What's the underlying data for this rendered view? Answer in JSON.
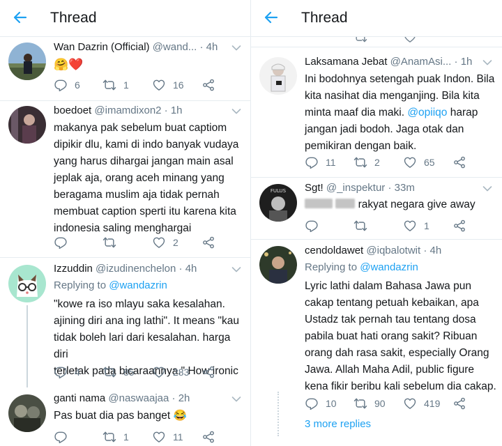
{
  "header": {
    "title": "Thread"
  },
  "left": [
    {
      "name": "Wan Dazrin (Official)",
      "handle": "@wand...",
      "dot": "·",
      "time": "4h",
      "body": [
        "🤗❤️"
      ],
      "reply": "6",
      "retweet": "1",
      "like": "16"
    },
    {
      "name": "boedoet",
      "handle": "@imamdixon2",
      "dot": "·",
      "time": "1h",
      "body": [
        "makanya pak sebelum buat captiom",
        "dipikir dlu, kami di indo banyak vudaya",
        "yang harus dihargai jangan main asal",
        "jeplak aja, orang aceh minang yang",
        "beragama muslim aja tidak pernah",
        "membuat caption sperti itu karena kita",
        "indonesia saling menghargai"
      ],
      "reply": "",
      "retweet": "",
      "like": "2"
    },
    {
      "name": "Izzuddin",
      "handle": "@izudinenchelon",
      "dot": "·",
      "time": "4h",
      "replying_prefix": "Replying to",
      "replying_to": "@wandazrin",
      "body": [
        "\"kowe ra iso mlayu saka kesalahan.",
        "ajining diri ana ing lathi\". It means \"kau",
        "tidak boleh lari dari kesalahan. harga diri",
        "terletak pada bicaraannya.\" How ironic"
      ],
      "reply": "4",
      "retweet": "85",
      "like": "283"
    },
    {
      "name": "ganti nama",
      "handle": "@naswaajaa",
      "dot": "·",
      "time": "2h",
      "body": [
        "Pas buat dia pas banget 😂"
      ],
      "reply": "",
      "retweet": "1",
      "like": "11"
    }
  ],
  "right": [
    {
      "name": "Laksamana Jebat",
      "handle": "@AnamAsi...",
      "dot": "·",
      "time": "1h",
      "body": [
        "Ini bodohnya setengah puak Indon. Bila",
        "kita nasihat dia menganjing. Bila kita",
        "minta maaf dia maki. ",
        "jangan jadi bodoh. Jaga otak dan",
        "pemikiran dengan baik."
      ],
      "mention": "@opiiqo",
      "mention_after": " harap",
      "reply": "11",
      "retweet": "2",
      "like": "65"
    },
    {
      "name": "Sgt!",
      "handle": "@_inspektur",
      "dot": "·",
      "time": "33m",
      "body": [
        "rakyat negara give away"
      ],
      "reply": "",
      "retweet": "",
      "like": "1",
      "avatar_text": "FULUS"
    },
    {
      "name": "cendoldawet",
      "handle": "@iqbalotwit",
      "dot": "·",
      "time": "4h",
      "replying_prefix": "Replying to",
      "replying_to": "@wandazrin",
      "body": [
        "Lyric lathi dalam Bahasa Jawa pun",
        "cakap tentang petuah kebaikan, apa",
        "Ustadz tak pernah tau tentang dosa",
        "pabila buat hati orang sakit? Ribuan",
        "orang dah rasa sakit, especially Orang",
        "Jawa. Allah Maha Adil, public figure",
        "kena fikir beribu kali sebelum dia cakap."
      ],
      "reply": "10",
      "retweet": "90",
      "like": "419"
    }
  ],
  "more_replies": "3 more replies",
  "colors": {
    "accent": "#1da1f2",
    "secondary_text": "#657786",
    "divider": "#e6ecf0"
  }
}
